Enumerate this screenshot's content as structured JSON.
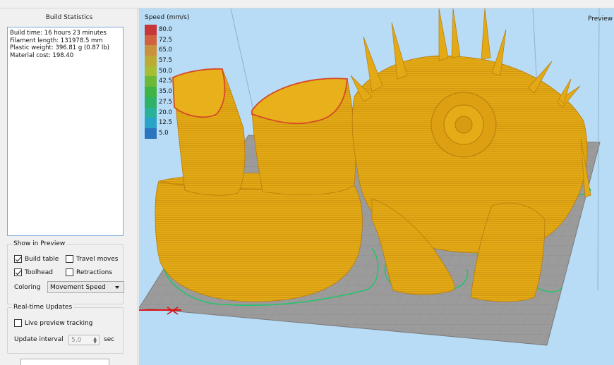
{
  "build_statistics": {
    "title": "Build Statistics",
    "lines": [
      "Build time: 16 hours 23 minutes",
      "Filament length: 131978.5 mm",
      "Plastic weight: 396.81 g (0.87 lb)",
      "Material cost: 198.40"
    ]
  },
  "show_in_preview": {
    "title": "Show in Preview",
    "build_table": {
      "label": "Build table",
      "checked": true
    },
    "travel_moves": {
      "label": "Travel moves",
      "checked": false
    },
    "toolhead": {
      "label": "Toolhead",
      "checked": true
    },
    "retractions": {
      "label": "Retractions",
      "checked": false
    },
    "coloring_label": "Coloring",
    "coloring_value": "Movement Speed"
  },
  "realtime_updates": {
    "title": "Real-time Updates",
    "live_tracking": {
      "label": "Live preview tracking",
      "checked": false
    },
    "interval_label": "Update interval",
    "interval_value": "5,0",
    "interval_unit": "sec"
  },
  "viewport": {
    "legend_title": "Speed (mm/s)",
    "legend": [
      {
        "value": "80.0",
        "color": "#c8363a"
      },
      {
        "value": "72.5",
        "color": "#d2613d"
      },
      {
        "value": "65.0",
        "color": "#c9913c"
      },
      {
        "value": "57.5",
        "color": "#bcaa33"
      },
      {
        "value": "50.0",
        "color": "#a6bd34"
      },
      {
        "value": "42.5",
        "color": "#6db937"
      },
      {
        "value": "35.0",
        "color": "#3fb444"
      },
      {
        "value": "27.5",
        "color": "#2eb265"
      },
      {
        "value": "20.0",
        "color": "#2ab19a"
      },
      {
        "value": "12.5",
        "color": "#2aa3c8"
      },
      {
        "value": "5.0",
        "color": "#2d74c0"
      }
    ],
    "preview_label": "Preview M",
    "model_color": "#e0a817",
    "bed_color": "#9b9b9b",
    "skirt_color": "#21c46a"
  }
}
